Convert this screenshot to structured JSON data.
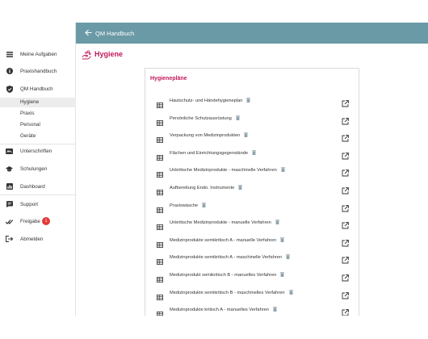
{
  "app": {
    "header_title": "QM Handbuch",
    "page_title": "Hygiene",
    "accent_color": "#c2185b",
    "topbar_color": "#6a9aa5"
  },
  "sidebar": {
    "items": [
      {
        "label": "Meine Aufgaben",
        "icon": "tasks-icon"
      },
      {
        "label": "Praxishandbuch",
        "icon": "info-icon"
      },
      {
        "label": "QM Handbuch",
        "icon": "shield-check-icon"
      },
      {
        "label": "Unterschriften",
        "icon": "signature-icon"
      },
      {
        "label": "Schulungen",
        "icon": "graduation-cap-icon"
      },
      {
        "label": "Dashboard",
        "icon": "dashboard-icon"
      },
      {
        "label": "Support",
        "icon": "support-icon"
      },
      {
        "label": "Freigabe",
        "icon": "approval-icon"
      },
      {
        "label": "Abmelden",
        "icon": "logout-icon"
      }
    ],
    "subitems": [
      "Hygiene",
      "Praxis",
      "Personal",
      "Geräte"
    ],
    "active_subitem": "Hygiene",
    "freigabe_badge": "1"
  },
  "card": {
    "heading": "Hygienepläne",
    "rows": [
      "Hautschutz- und Händehygieneplan",
      "Persönliche Schutzausrüstung",
      "Verpackung von Medizinprodukten",
      "Flächen und Einrichtungsgegenstände",
      "Unkritische Medizinprodukte - maschinelle Verfahren",
      "Aufbereitung Endo. Instrumente",
      "Praxiswäsche",
      "Unkritische Medizinprodukte - manuelle Verfahren",
      "Medizinprodukte semikritisch A - manuelle Verfahren",
      "Medizinprodukte semikritisch A - maschinelle Verfahren",
      "Medizinprodukt semikritisch B - manuelles Verfahren",
      "Medizinprodukte semikritisch B - maschinelles Verfahren",
      "Medizinprodukte kritisch A - manuelles Verfahren"
    ]
  }
}
